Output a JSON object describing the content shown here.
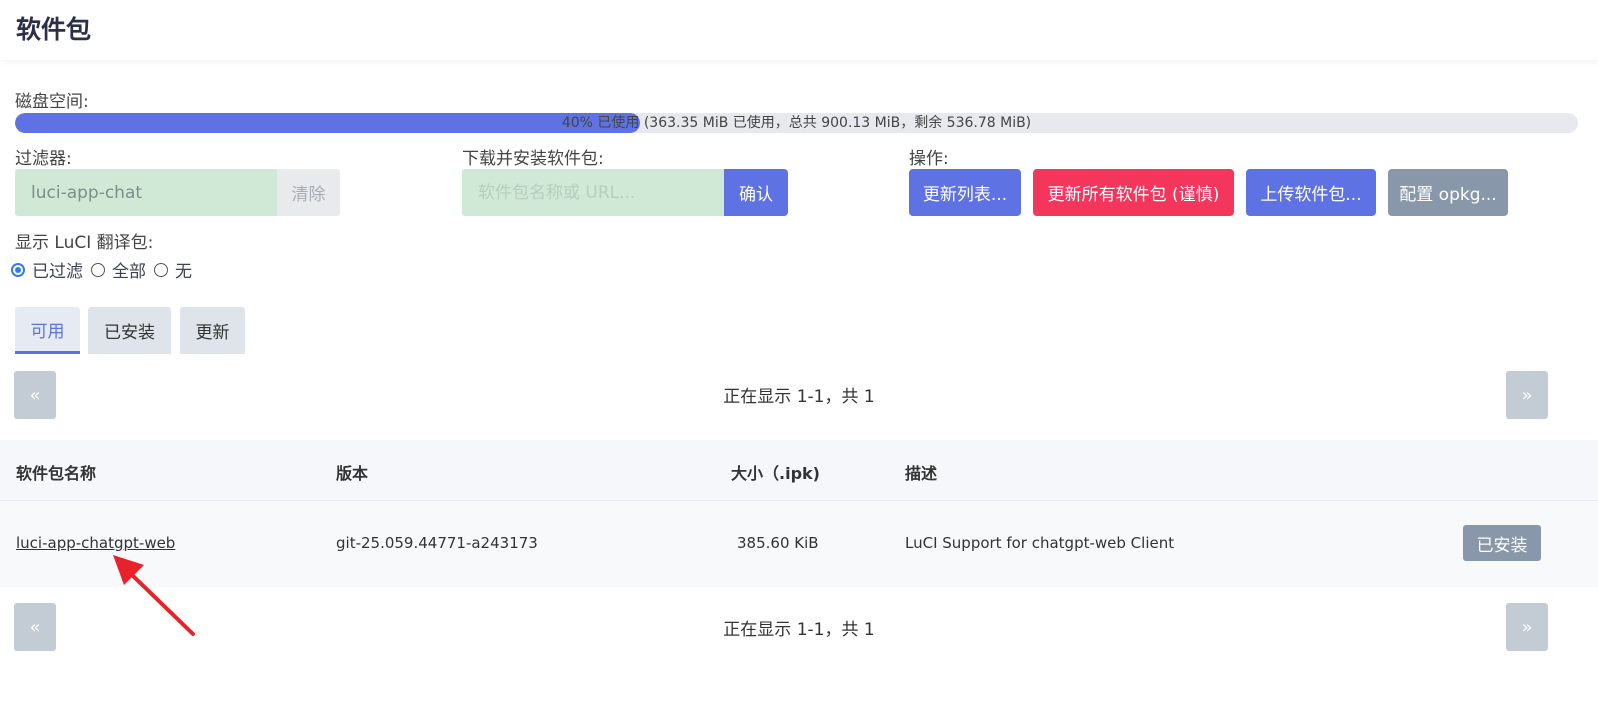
{
  "page": {
    "title": "软件包"
  },
  "disk": {
    "label": "磁盘空间:",
    "used_fraction": 0.4,
    "text": "40% 已使用 (363.35 MiB 已使用，总共 900.13 MiB，剩余 536.78 MiB)"
  },
  "filter": {
    "label": "过滤器:",
    "value": "luci-app-chat",
    "clear_label": "清除"
  },
  "download": {
    "label": "下载并安装软件包:",
    "placeholder": "软件包名称或 URL...",
    "confirm_label": "确认"
  },
  "actions": {
    "label": "操作:",
    "update_lists": "更新列表...",
    "upgrade_all": "更新所有软件包 (谨慎)",
    "upload": "上传软件包...",
    "configure": "配置 opkg..."
  },
  "translations": {
    "label": "显示 LuCI 翻译包:",
    "options": [
      "已过滤",
      "全部",
      "无"
    ],
    "selected": "已过滤"
  },
  "tabs": {
    "available": "可用",
    "installed": "已安装",
    "updates": "更新"
  },
  "pager": {
    "prev": "«",
    "next": "»",
    "text": "正在显示 1-1，共 1"
  },
  "table": {
    "headers": {
      "name": "软件包名称",
      "version": "版本",
      "size": "大小（.ipk)",
      "description": "描述"
    },
    "rows": [
      {
        "name": "luci-app-chatgpt-web",
        "version": "git-25.059.44771-a243173",
        "size": "385.60 KiB",
        "description": "LuCI Support for chatgpt-web Client",
        "action": "已安装"
      }
    ]
  },
  "colors": {
    "accent": "#5e72e4",
    "danger": "#f5365c",
    "muted": "#8898aa",
    "annotation_arrow": "#e8212a"
  }
}
